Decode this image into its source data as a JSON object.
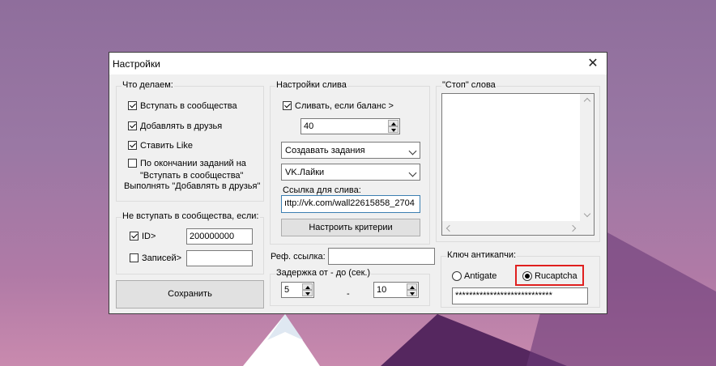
{
  "window": {
    "title": "Настройки",
    "close_glyph": "✕"
  },
  "what_we_do": {
    "legend": "Что делаем:",
    "items": [
      {
        "label": "Вступать в сообщества",
        "checked": true
      },
      {
        "label": "Добавлять в друзья",
        "checked": true
      },
      {
        "label": "Ставить Like",
        "checked": true
      },
      {
        "label": "По окончании заданий на",
        "checked": false
      }
    ],
    "note_line1": "\"Вступать в сообщества\"",
    "note_line2": "Выполнять \"Добавлять в друзья\""
  },
  "no_join": {
    "legend": "Не вступать в сообщества, если:",
    "id_label": "ID>",
    "id_checked": true,
    "id_value": "200000000",
    "posts_label": "Записей>",
    "posts_checked": false,
    "posts_value": ""
  },
  "save_label": "Сохранить",
  "drain": {
    "legend": "Настройки слива",
    "drain_label": "Сливать, если баланс >",
    "drain_checked": true,
    "balance_value": "40",
    "task_select": "Создавать задания",
    "type_select": "VK.Лайки",
    "link_label": "Ссылка для слива:",
    "link_value": "ıttp://vk.com/wall22615858_2704",
    "criteria_button": "Настроить критерии"
  },
  "ref": {
    "label": "Реф. ссылка:",
    "value": ""
  },
  "delay": {
    "legend": "Задержка от - до (сек.)",
    "from_value": "5",
    "dash": "-",
    "to_value": "10"
  },
  "stop_words": {
    "legend": "\"Стоп\" слова"
  },
  "anticaptcha": {
    "legend": "Ключ антикапчи:",
    "option1": "Antigate",
    "option1_selected": false,
    "option2": "Rucaptcha",
    "option2_selected": true,
    "key_value": "****************************"
  },
  "colors": {
    "highlight": "#e0201f",
    "focus": "#3c7fb1"
  }
}
